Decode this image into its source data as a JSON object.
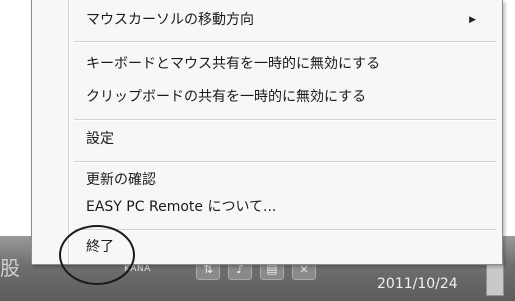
{
  "menu": {
    "items": [
      {
        "label": "マウスカーソルの移動方向",
        "submenu": true
      },
      {
        "label": "キーボードとマウス共有を一時的に無効にする"
      },
      {
        "label": "クリップボードの共有を一時的に無効にする"
      },
      {
        "label": "設定"
      },
      {
        "label": "更新の確認"
      },
      {
        "label": "EASY PC Remote について..."
      },
      {
        "label": "終了"
      }
    ],
    "submenu_arrow": "▶"
  },
  "taskbar": {
    "ime_label": "KANA",
    "date": "2011/10/24",
    "left_glyph": "股",
    "icons": [
      "network-icon",
      "volume-icon",
      "keyboard-icon",
      "power-icon"
    ]
  }
}
